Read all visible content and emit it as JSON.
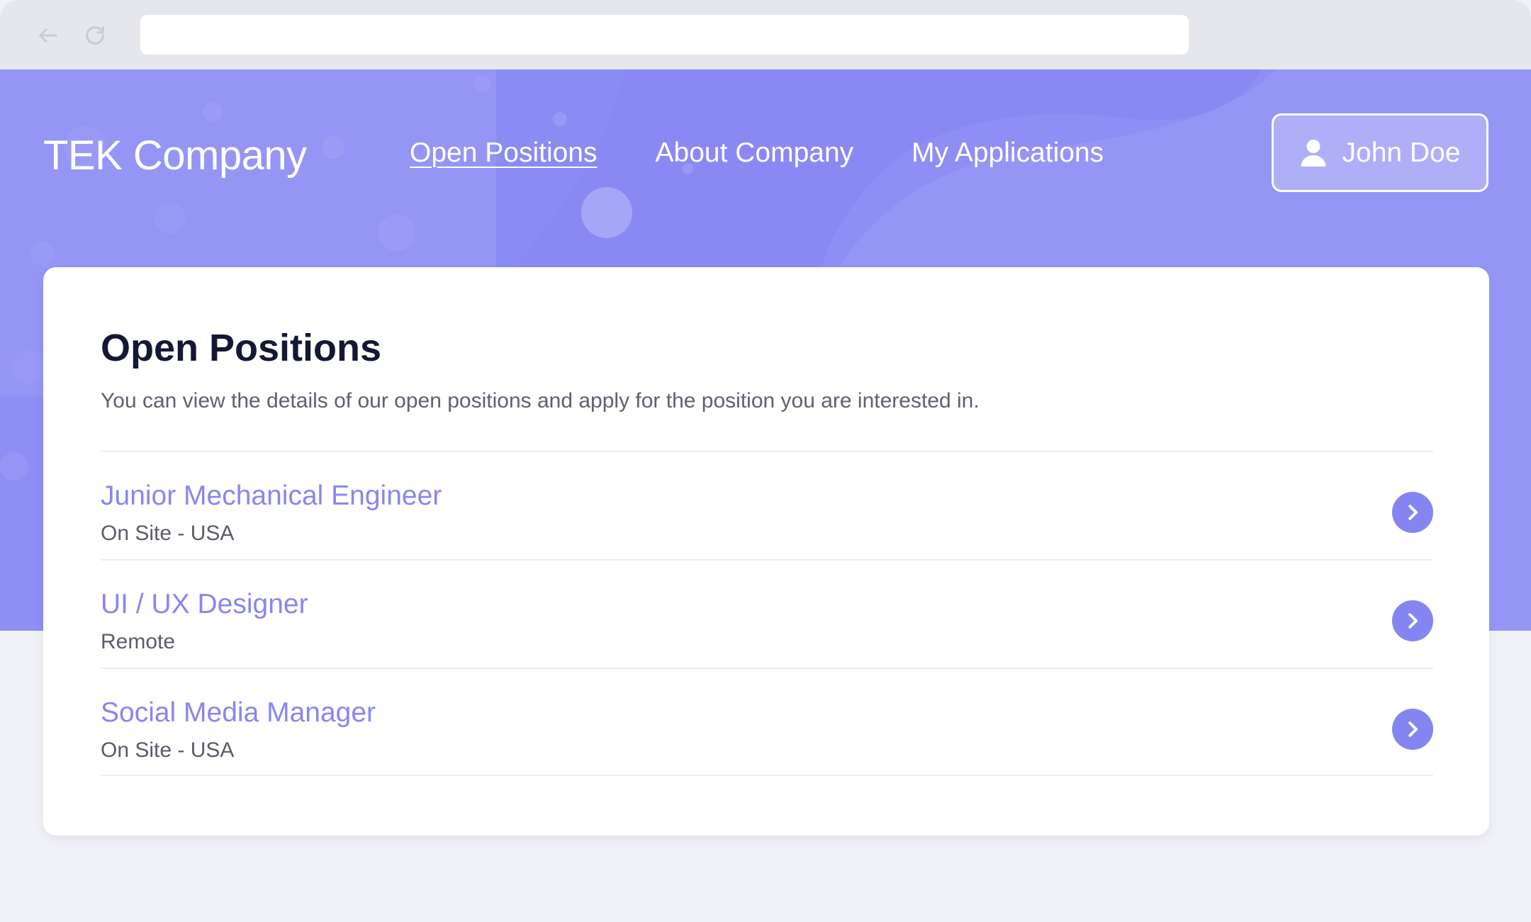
{
  "browser": {
    "url": "",
    "icons": {
      "back": "arrow-left-icon",
      "reload": "reload-icon"
    }
  },
  "header": {
    "brand": "TEK Company",
    "nav": [
      {
        "label": "Open Positions",
        "active": true
      },
      {
        "label": "About Company",
        "active": false
      },
      {
        "label": "My Applications",
        "active": false
      }
    ],
    "user": {
      "name": "John Doe",
      "icon": "user-icon"
    }
  },
  "main": {
    "title": "Open Positions",
    "description": "You can view the details of our open positions and apply for the position you are interested in.",
    "positions": [
      {
        "title": "Junior Mechanical Engineer",
        "meta": "On Site -  USA"
      },
      {
        "title": "UI / UX Designer",
        "meta": "Remote"
      },
      {
        "title": "Social Media Manager",
        "meta": "On Site -  USA"
      }
    ]
  },
  "colors": {
    "hero": "#8f8ef5",
    "accent": "#8585f1",
    "position_title": "#8a86ee",
    "heading": "#141832",
    "page_bg": "#f1f2f7"
  }
}
